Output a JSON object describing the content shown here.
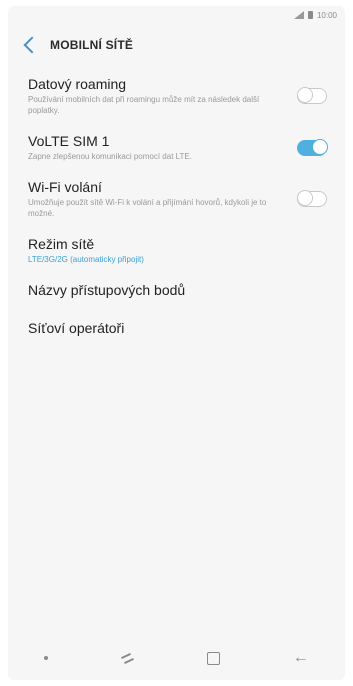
{
  "status_bar": {
    "time": "10:00"
  },
  "app_bar": {
    "title": "MOBILNÍ SÍTĚ"
  },
  "settings": [
    {
      "title": "Datový roaming",
      "subtitle": "Používání mobilních dat při roamingu může mít za následek další poplatky.",
      "toggle": "off"
    },
    {
      "title": "VoLTE SIM 1",
      "subtitle": "Zapne zlepšenou komunikaci pomocí dat LTE.",
      "toggle": "on"
    },
    {
      "title": "Wi-Fi volání",
      "subtitle": "Umožňuje použít sítě Wi-Fi k volání a přijímání hovorů, kdykoli je to možné.",
      "toggle": "off"
    },
    {
      "title": "Režim sítě",
      "subtitle": "LTE/3G/2G (automaticky připojit)"
    },
    {
      "title": "Názvy přístupových bodů"
    },
    {
      "title": "Síťoví operátoři"
    }
  ],
  "colors": {
    "accent": "#4fb0e0",
    "background": "#f6f6f6"
  }
}
